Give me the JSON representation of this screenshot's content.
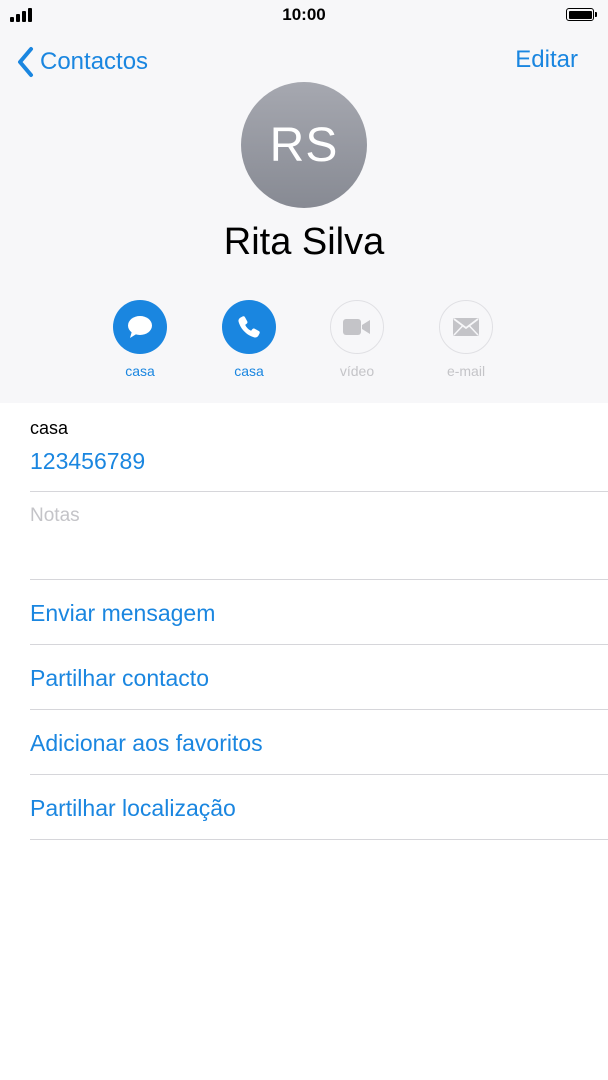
{
  "status_bar": {
    "time": "10:00",
    "icons": [
      "signal-icon",
      "battery-icon"
    ]
  },
  "nav": {
    "back_label": "Contactos",
    "back_icon": "chevron-left-icon",
    "edit_label": "Editar"
  },
  "contact": {
    "initials": "RS",
    "name": "Rita Silva"
  },
  "actions": [
    {
      "icon": "message-icon",
      "label": "casa",
      "enabled": true
    },
    {
      "icon": "phone-icon",
      "label": "casa",
      "enabled": true
    },
    {
      "icon": "video-icon",
      "label": "vídeo",
      "enabled": false
    },
    {
      "icon": "mail-icon",
      "label": "e-mail",
      "enabled": false
    }
  ],
  "phone": {
    "type": "casa",
    "number": "123456789"
  },
  "notes": {
    "placeholder": "Notas"
  },
  "options": [
    "Enviar mensagem",
    "Partilhar contacto",
    "Adicionar aos favoritos",
    "Partilhar localização"
  ],
  "colors": {
    "accent": "#1a86e0",
    "header_bg": "#f7f7f9",
    "disabled": "#c4c4c8",
    "divider": "#d6d6da"
  }
}
